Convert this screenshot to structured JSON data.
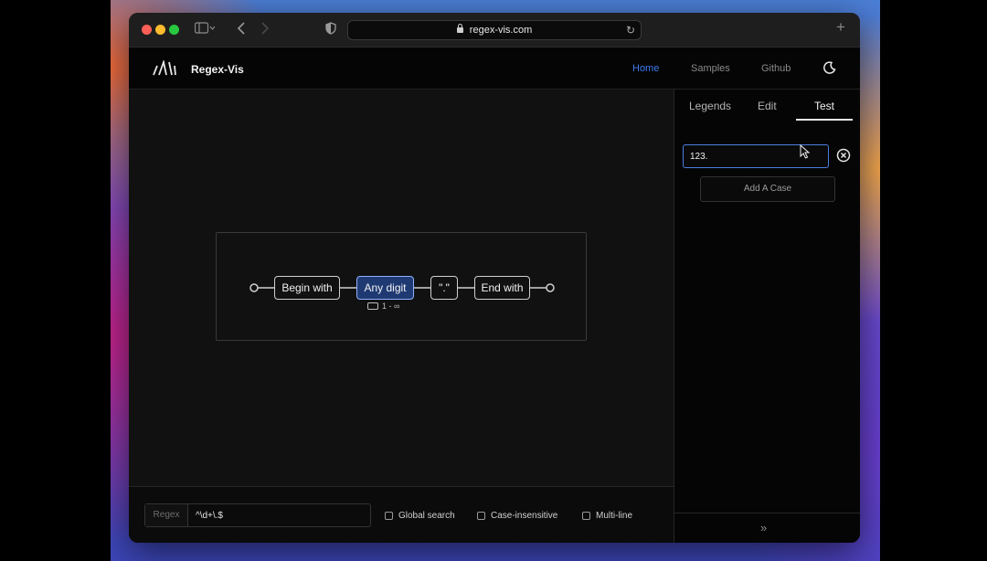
{
  "browser": {
    "url": "regex-vis.com"
  },
  "app": {
    "title": "Regex-Vis",
    "nav": [
      {
        "label": "Home",
        "active": true
      },
      {
        "label": "Samples",
        "active": false
      },
      {
        "label": "Github",
        "active": false
      }
    ]
  },
  "graph": {
    "nodes": [
      {
        "label": "Begin with",
        "highlighted": false
      },
      {
        "label": "Any digit",
        "highlighted": true
      },
      {
        "label": "\".\"",
        "highlighted": false
      },
      {
        "label": "End with",
        "highlighted": false
      }
    ],
    "quantifier": "1 - ∞"
  },
  "bottom": {
    "regex_label": "Regex",
    "regex_value": "^\\d+\\.$",
    "options": [
      {
        "label": "Global search",
        "checked": false
      },
      {
        "label": "Case-insensitive",
        "checked": false
      },
      {
        "label": "Multi-line",
        "checked": false
      }
    ]
  },
  "panel": {
    "tabs": [
      {
        "label": "Legends",
        "active": false
      },
      {
        "label": "Edit",
        "active": false
      },
      {
        "label": "Test",
        "active": true
      }
    ],
    "case_value": "123.",
    "add_case_label": "Add A Case",
    "collapse_label": "»"
  },
  "colors": {
    "accent": "#3d7bf0",
    "node_highlight": "#1f3a73"
  }
}
